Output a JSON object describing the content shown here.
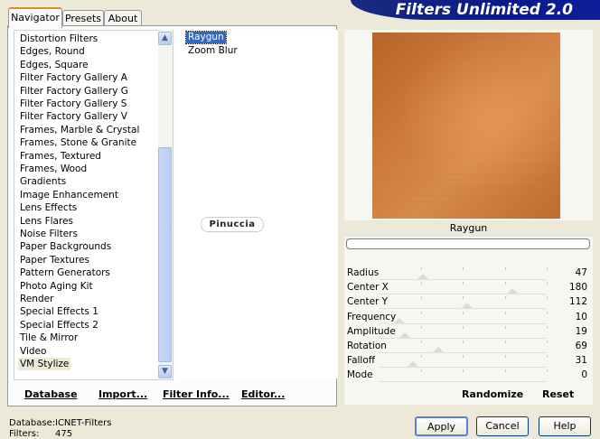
{
  "banner": {
    "title": "Filters Unlimited 2.0"
  },
  "tabs": [
    {
      "label": "Navigator",
      "active": true
    },
    {
      "label": "Presets",
      "active": false
    },
    {
      "label": "About",
      "active": false
    }
  ],
  "categories": [
    "Distortion Filters",
    "Edges, Round",
    "Edges, Square",
    "Filter Factory Gallery A",
    "Filter Factory Gallery G",
    "Filter Factory Gallery S",
    "Filter Factory Gallery V",
    "Frames, Marble & Crystal",
    "Frames, Stone & Granite",
    "Frames, Textured",
    "Frames, Wood",
    "Gradients",
    "Image Enhancement",
    "Lens Effects",
    "Lens Flares",
    "Noise Filters",
    "Paper Backgrounds",
    "Paper Textures",
    "Pattern Generators",
    "Photo Aging Kit",
    "Render",
    "Special Effects 1",
    "Special Effects 2",
    "Tile & Mirror",
    "Video",
    "VM Stylize"
  ],
  "selected_category": "VM Stylize",
  "filters": [
    "Raygun",
    "Zoom Blur"
  ],
  "selected_filter": "Raygun",
  "watermark": "Pinuccia",
  "panel_buttons": {
    "database": "Database",
    "import": "Import...",
    "filter_info": "Filter Info...",
    "editor": "Editor..."
  },
  "preview": {
    "filter_name": "Raygun"
  },
  "parameters": [
    {
      "label": "Radius",
      "value": "47",
      "level": 0.18
    },
    {
      "label": "Center X",
      "value": "180",
      "level": 0.71
    },
    {
      "label": "Center Y",
      "value": "112",
      "level": 0.44
    },
    {
      "label": "Frequency",
      "value": "10",
      "level": 0.04
    },
    {
      "label": "Amplitude",
      "value": "19",
      "level": 0.07
    },
    {
      "label": "Rotation",
      "value": "69",
      "level": 0.27
    },
    {
      "label": "Falloff",
      "value": "31",
      "level": 0.12
    },
    {
      "label": "Mode",
      "value": "0",
      "level": 0.0
    }
  ],
  "right_buttons": {
    "randomize": "Randomize",
    "reset": "Reset"
  },
  "status": {
    "database_label": "Database:",
    "database_value": "ICNET-Filters",
    "filters_label": "Filters:",
    "filters_value": "475"
  },
  "dialog_buttons": {
    "apply": "Apply",
    "cancel": "Cancel",
    "help": "Help"
  }
}
